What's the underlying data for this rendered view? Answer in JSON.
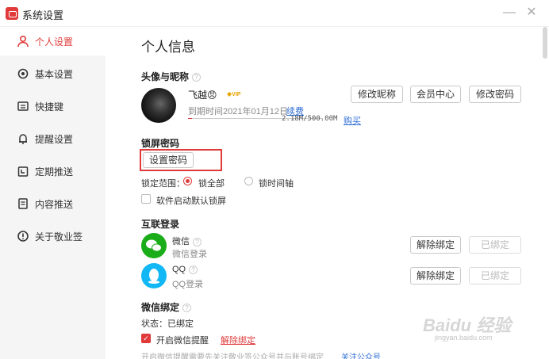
{
  "window": {
    "title": "系统设置",
    "min_label": "—",
    "close_label": "✕"
  },
  "sidebar": {
    "items": [
      {
        "label": "个人设置",
        "icon": "person-icon"
      },
      {
        "label": "基本设置",
        "icon": "gear-icon"
      },
      {
        "label": "快捷键",
        "icon": "keyboard-icon"
      },
      {
        "label": "提醒设置",
        "icon": "bell-icon"
      },
      {
        "label": "定期推送",
        "icon": "calendar-icon"
      },
      {
        "label": "内容推送",
        "icon": "document-icon"
      },
      {
        "label": "关于敬业签",
        "icon": "info-icon"
      }
    ],
    "active_index": 0
  },
  "main": {
    "title": "个人信息",
    "profile": {
      "section_title": "头像与昵称",
      "nickname": "飞越😠",
      "vip_badge": "VIP",
      "expire_text": "到期时间2021年01月12日",
      "renew_link": "续费",
      "storage_text": "2.18M/500.00M",
      "storage_fraction": 0.0044,
      "buy_link": "购买",
      "buttons": {
        "edit_nickname": "修改昵称",
        "member_center": "会员中心",
        "change_password": "修改密码"
      }
    },
    "lock": {
      "section_title": "锁屏密码",
      "set_password_button": "设置密码",
      "scope_label": "锁定范围：",
      "scope_all": "锁全部",
      "scope_timeline": "锁时间轴",
      "default_lock_label": "软件启动默认锁屏"
    },
    "login": {
      "section_title": "互联登录",
      "wechat": {
        "name": "微信",
        "sub": "微信登录",
        "unbind": "解除绑定",
        "bound": "已绑定"
      },
      "qq": {
        "name": "QQ",
        "sub": "QQ登录",
        "unbind": "解除绑定",
        "bound": "已绑定"
      }
    },
    "wechat_bind": {
      "section_title": "微信绑定",
      "status_text": "状态：已绑定",
      "reminder_label": "开启微信提醒",
      "unbind_link": "解除绑定",
      "note_text": "开启微信提醒需要先关注敬业签公众号并与账号绑定",
      "follow_link": "关注公众号"
    }
  },
  "watermark": {
    "brand": "Baidu 经验",
    "url": "jingyan.baidu.com"
  }
}
